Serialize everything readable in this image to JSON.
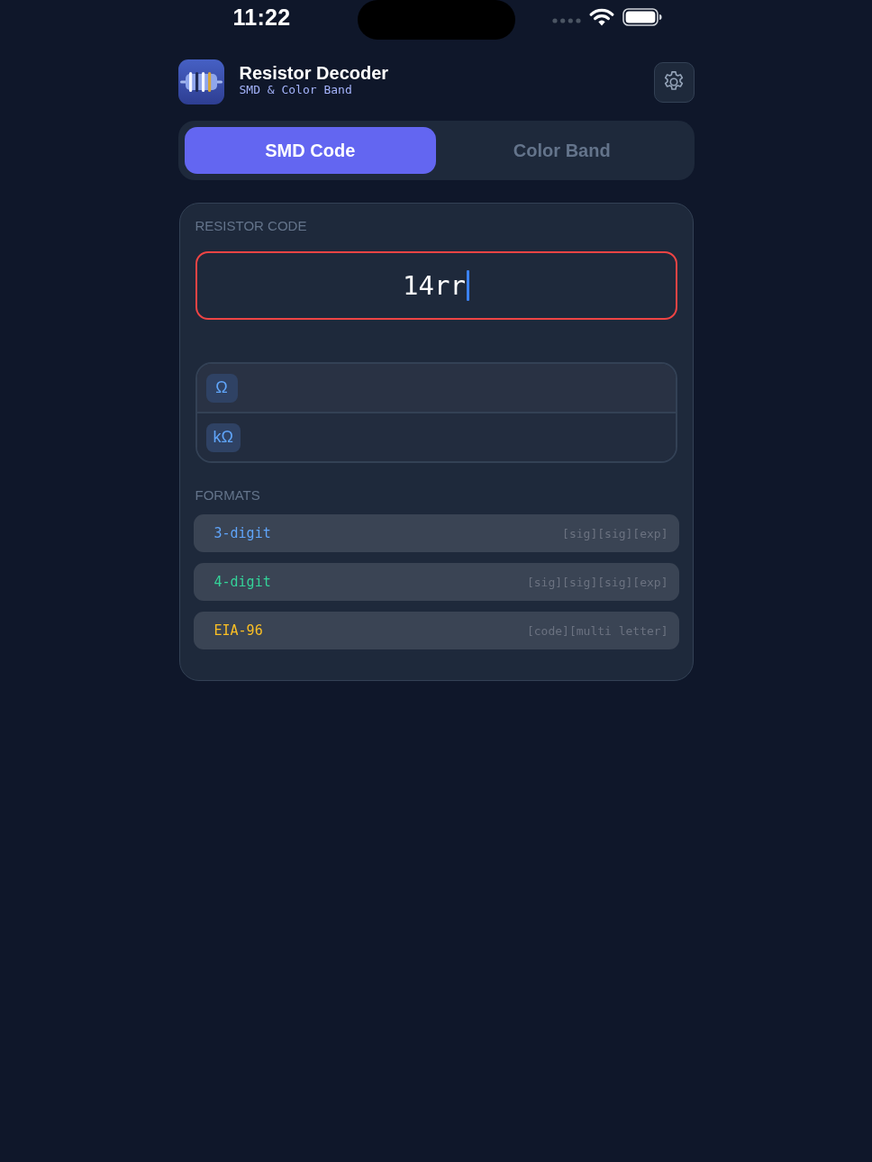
{
  "status_bar": {
    "time": "11:22"
  },
  "header": {
    "title": "Resistor Decoder",
    "subtitle": "SMD & Color Band"
  },
  "tabs": [
    {
      "label": "SMD Code",
      "selected": true
    },
    {
      "label": "Color Band",
      "selected": false
    }
  ],
  "code_input": {
    "label": "RESISTOR CODE",
    "value": "14rr",
    "invalid": true
  },
  "results": [
    {
      "unit": "Ω"
    },
    {
      "unit": "kΩ"
    }
  ],
  "formats": {
    "label": "FORMATS",
    "items": [
      {
        "name": "3-digit",
        "pattern": "[sig][sig][exp]",
        "color": "#60a5fa"
      },
      {
        "name": "4-digit",
        "pattern": "[sig][sig][sig][exp]",
        "color": "#34d399"
      },
      {
        "name": "EIA-96",
        "pattern": "[code][multi letter]",
        "color": "#fbbf24"
      }
    ]
  }
}
